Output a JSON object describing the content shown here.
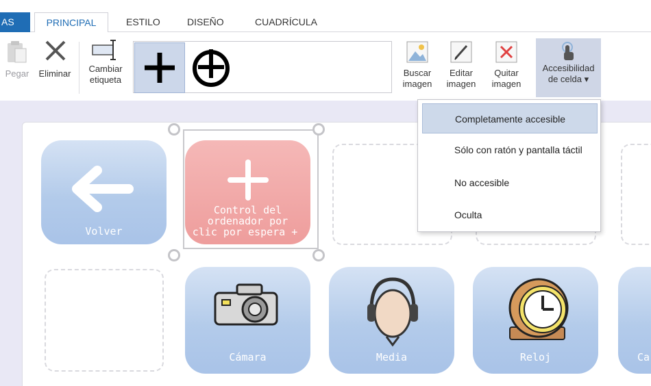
{
  "tabs": {
    "previous_partial": "AS",
    "items": [
      {
        "label": "PRINCIPAL",
        "active": true
      },
      {
        "label": "ESTILO",
        "active": false
      },
      {
        "label": "DISEÑO",
        "active": false
      },
      {
        "label": "CUADRÍCULA",
        "active": false
      }
    ]
  },
  "ribbon": {
    "paste_label": "Pegar",
    "delete_label": "Eliminar",
    "change_label_line1": "Cambiar",
    "change_label_line2": "etiqueta",
    "gallery_icons": [
      "plus-icon",
      "circle-plus-icon"
    ],
    "find_image_line1": "Buscar",
    "find_image_line2": "imagen",
    "edit_image_line1": "Editar",
    "edit_image_line2": "imagen",
    "remove_image_line1": "Quitar",
    "remove_image_line2": "imagen",
    "accessibility_line1": "Accesibilidad",
    "accessibility_line2": "de celda ▾"
  },
  "accessibility_menu": {
    "options": [
      "Completamente accesible",
      "Sólo con ratón y pantalla táctil",
      "No accesible",
      "Oculta"
    ],
    "highlighted_index": 0
  },
  "grid": {
    "cells": [
      {
        "label": "Volver",
        "icon": "arrow-left-icon"
      },
      {
        "label_lines": [
          "Control del",
          "ordenador por",
          "clic por espera +"
        ],
        "icon": "plus-icon",
        "selected": true
      },
      {
        "label": "Cámara",
        "icon": "camera-icon"
      },
      {
        "label": "Media",
        "icon": "headphones-icon"
      },
      {
        "label": "Reloj",
        "icon": "clock-icon"
      },
      {
        "label": "Ca",
        "icon": ""
      }
    ]
  },
  "colors": {
    "accent": "#1f6db5",
    "cell_blue": "#a9c3e8",
    "cell_red": "#ef9d9c",
    "menu_highlight": "#cdd9ea"
  }
}
